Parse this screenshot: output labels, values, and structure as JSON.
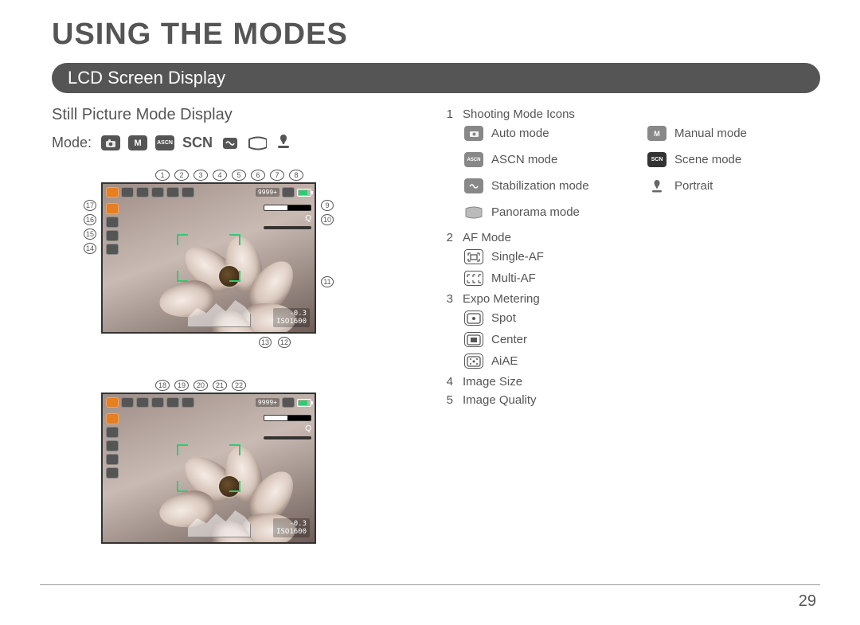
{
  "page_number": "29",
  "title": "USING THE MODES",
  "section": "LCD Screen Display",
  "subsection": "Still Picture Mode Display",
  "mode_label": "Mode:",
  "mode_icons": [
    {
      "name": "auto-icon",
      "text": ""
    },
    {
      "name": "manual-icon",
      "text": "M"
    },
    {
      "name": "ascn-icon",
      "text": "ASCN"
    },
    {
      "name": "scn-icon-plain",
      "text": "SCN"
    },
    {
      "name": "stabilization-icon",
      "text": ""
    },
    {
      "name": "panorama-icon",
      "text": ""
    },
    {
      "name": "portrait-icon",
      "text": ""
    }
  ],
  "lcd": {
    "remaining": "9999+",
    "ev": "-0.3",
    "iso": "ISO1600",
    "zoom": "Q"
  },
  "callouts": {
    "top1": [
      "1",
      "2",
      "3",
      "4",
      "5",
      "6",
      "7",
      "8"
    ],
    "right1": [
      "9",
      "10",
      "11"
    ],
    "left1": [
      "17",
      "16",
      "15",
      "14"
    ],
    "bottom1": [
      "13",
      "12"
    ],
    "top2": [
      "18",
      "19",
      "20",
      "21",
      "22"
    ]
  },
  "legend": {
    "n1": {
      "num": "1",
      "label": "Shooting Mode Icons"
    },
    "n1_items": {
      "auto": "Auto mode",
      "manual": "Manual mode",
      "ascn": "ASCN mode",
      "scene": "Scene mode",
      "stab": "Stabilization mode",
      "portrait": "Portrait",
      "pano": "Panorama mode"
    },
    "n2": {
      "num": "2",
      "label": "AF Mode"
    },
    "n2_items": {
      "single": "Single-AF",
      "multi": "Multi-AF"
    },
    "n3": {
      "num": "3",
      "label": "Expo Metering"
    },
    "n3_items": {
      "spot": "Spot",
      "center": "Center",
      "aiae": "AiAE"
    },
    "n4": {
      "num": "4",
      "label": "Image Size"
    },
    "n5": {
      "num": "5",
      "label": "Image Quality"
    }
  }
}
